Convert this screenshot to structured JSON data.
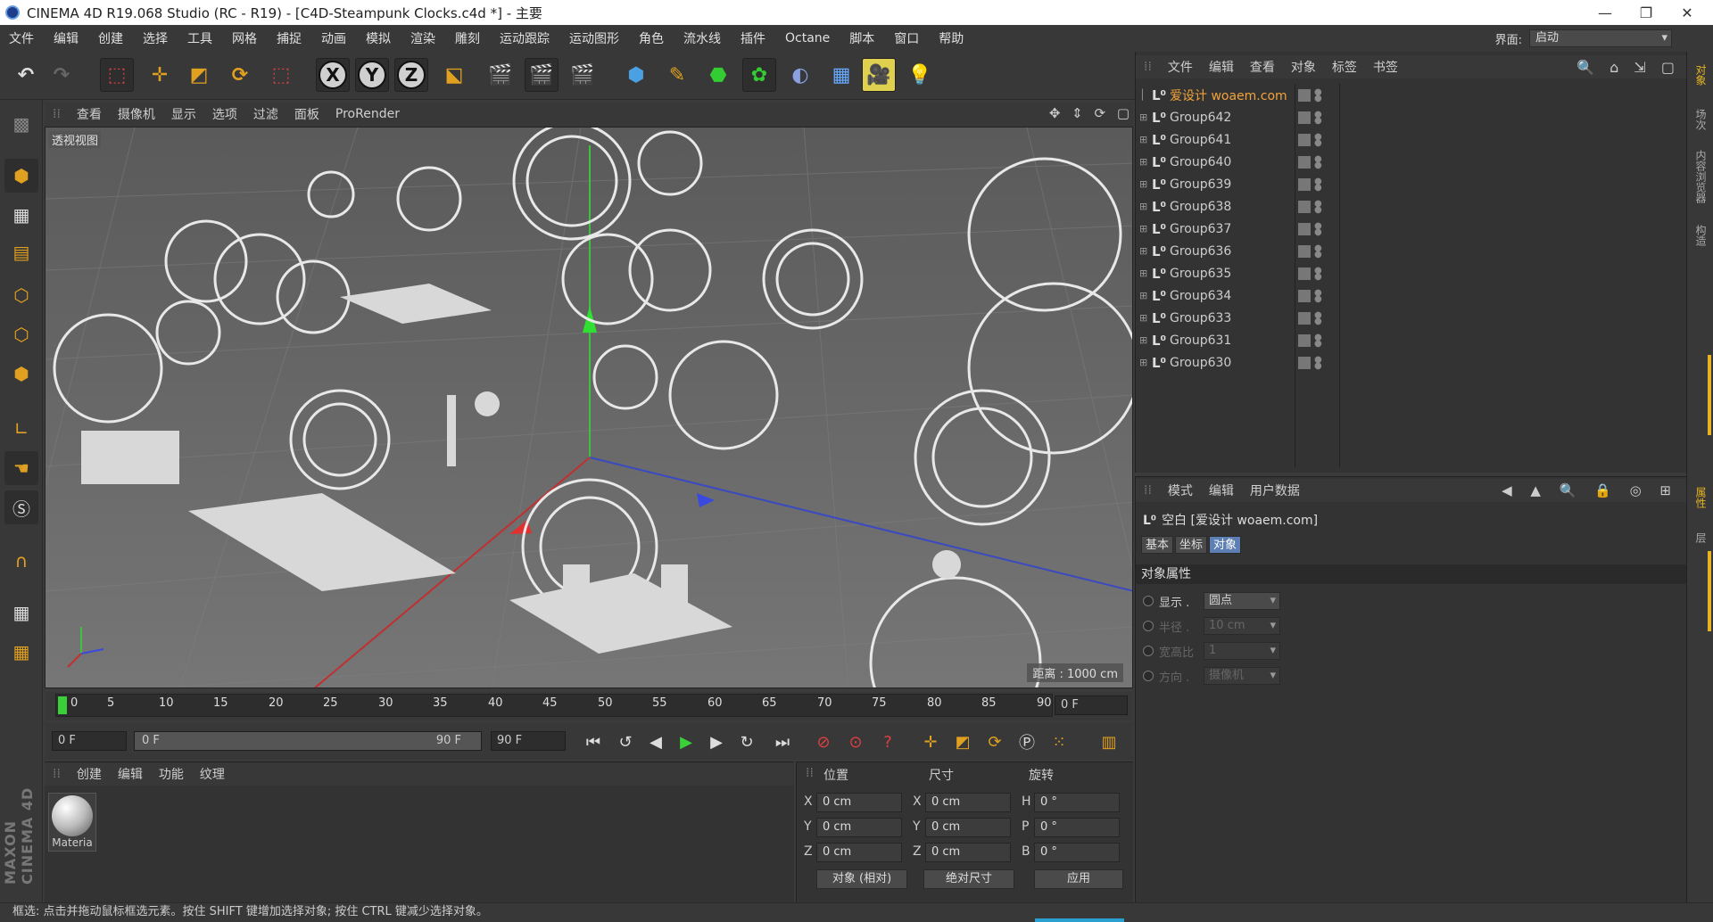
{
  "title": "CINEMA 4D R19.068 Studio (RC - R19) - [C4D-Steampunk Clocks.c4d *] - 主要",
  "menu": [
    "文件",
    "编辑",
    "创建",
    "选择",
    "工具",
    "网格",
    "捕捉",
    "动画",
    "模拟",
    "渲染",
    "雕刻",
    "运动跟踪",
    "运动图形",
    "角色",
    "流水线",
    "插件",
    "Octane",
    "脚本",
    "窗口",
    "帮助"
  ],
  "layout": {
    "label": "界面:",
    "value": "启动"
  },
  "viewport": {
    "menu": [
      "查看",
      "摄像机",
      "显示",
      "选项",
      "过滤",
      "面板",
      "ProRender"
    ],
    "label": "透视视图",
    "distance": "距离 : 1000 cm"
  },
  "timeline": {
    "ticks": [
      "0",
      "5",
      "10",
      "15",
      "20",
      "25",
      "30",
      "35",
      "40",
      "45",
      "50",
      "55",
      "60",
      "65",
      "70",
      "75",
      "80",
      "85",
      "90"
    ],
    "current": "0 F"
  },
  "transport": {
    "start": "0 F",
    "range_start": "0 F",
    "range_end": "90 F",
    "end": "90 F"
  },
  "material_panel": {
    "menu": [
      "创建",
      "编辑",
      "功能",
      "纹理"
    ],
    "material_name": "Materia"
  },
  "coords": {
    "headers": [
      "位置",
      "尺寸",
      "旋转"
    ],
    "axes": [
      "X",
      "Y",
      "Z"
    ],
    "size_axes": [
      "X",
      "Y",
      "Z"
    ],
    "rot_axes": [
      "H",
      "P",
      "B"
    ],
    "position": [
      "0 cm",
      "0 cm",
      "0 cm"
    ],
    "size": [
      "0 cm",
      "0 cm",
      "0 cm"
    ],
    "rotation": [
      "0 °",
      "0 °",
      "0 °"
    ],
    "mode1": "对象 (相对)",
    "mode2": "绝对尺寸",
    "apply": "应用"
  },
  "object_manager": {
    "menu": [
      "文件",
      "编辑",
      "查看",
      "对象",
      "标签",
      "书签"
    ],
    "highlight_color": "#f2a33a",
    "objects": [
      "爱设计 woaem.com",
      "Group642",
      "Group641",
      "Group640",
      "Group639",
      "Group638",
      "Group637",
      "Group636",
      "Group635",
      "Group634",
      "Group633",
      "Group631",
      "Group630"
    ]
  },
  "attribute_manager": {
    "menu": [
      "模式",
      "编辑",
      "用户数据"
    ],
    "title": "空白 [爱设计 woaem.com]",
    "tabs": [
      "基本",
      "坐标",
      "对象"
    ],
    "active_tab": "对象",
    "section": "对象属性",
    "display_label": "显示 .",
    "display_value": "圆点",
    "radius_label": "半径 .",
    "radius_value": "10 cm",
    "aspect_label": "宽高比",
    "aspect_value": "1",
    "orient_label": "方向 .",
    "orient_value": "摄像机"
  },
  "right_strip": [
    "对象",
    "场次",
    "内容浏览器",
    "构造",
    "属性",
    "层"
  ],
  "brand": "MAXON CINEMA 4D",
  "status": "框选: 点击并拖动鼠标框选元素。按住 SHIFT 键增加选择对象; 按住 CTRL 键减少选择对象。",
  "accent": "#5d7fb3"
}
